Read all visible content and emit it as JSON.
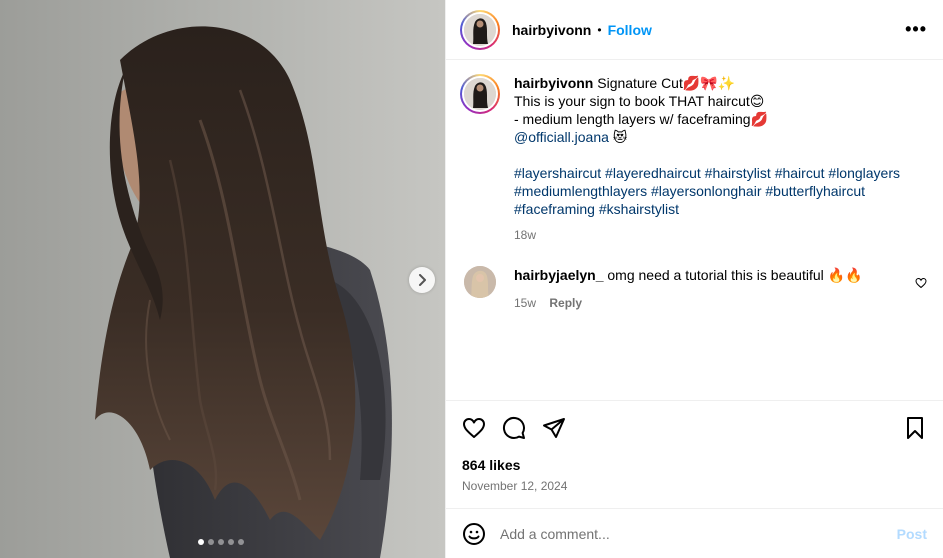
{
  "header": {
    "username": "hairbyivonn",
    "separator": "•",
    "follow_label": "Follow",
    "more_label": "•••"
  },
  "caption": {
    "username": "hairbyivonn",
    "line1": "Signature Cut💋🎀✨",
    "line2": "This is your sign to book THAT haircut😊",
    "line3": "- medium length layers w/ faceframing💋",
    "mention": "@officiall.joana",
    "mention_emoji": "😻",
    "hashtags": [
      "#layershaircut",
      "#layeredhaircut",
      "#hairstylist",
      "#haircut",
      "#longlayers",
      "#mediumlengthlayers",
      "#layersonlonghair",
      "#butterflyhaircut",
      "#faceframing",
      "#kshairstylist"
    ],
    "time": "18w"
  },
  "comment": {
    "username": "hairbyjaelyn_",
    "text": "omg need a tutorial this is beautiful 🔥🔥",
    "time": "15w",
    "reply_label": "Reply"
  },
  "stats": {
    "likes": "864 likes",
    "date": "November 12, 2024"
  },
  "add_comment": {
    "placeholder": "Add a comment...",
    "post_label": "Post"
  },
  "carousel": {
    "slide_count": 5,
    "active_slide": 1
  },
  "colors": {
    "accent": "#0095f6",
    "link": "#00376b",
    "muted": "#737373",
    "post_disabled": "#b3dbff"
  }
}
